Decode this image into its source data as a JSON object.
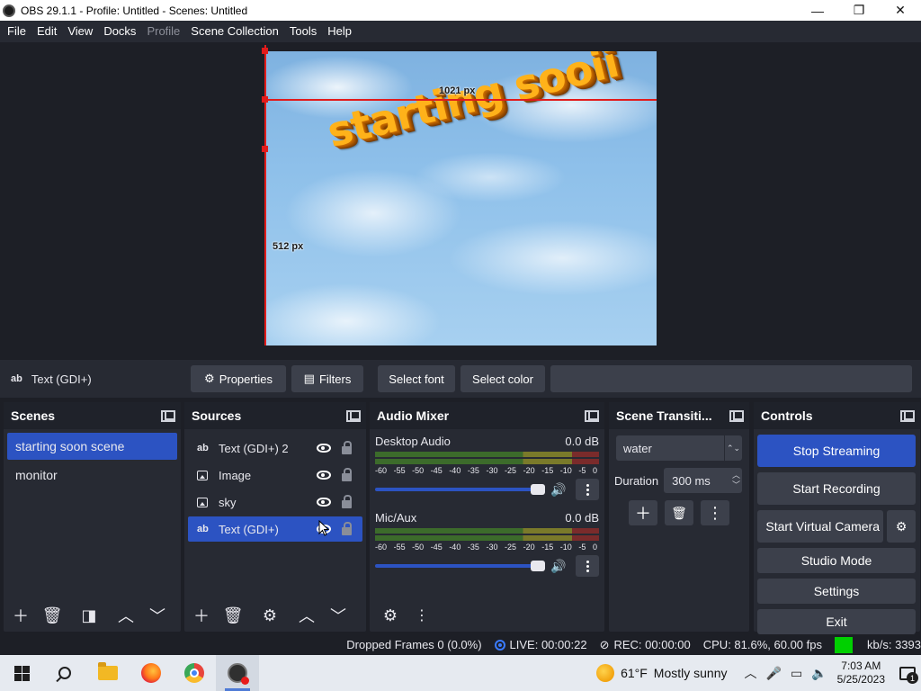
{
  "window": {
    "title": "OBS 29.1.1 - Profile: Untitled - Scenes: Untitled",
    "minimize": "—",
    "maximize": "❐",
    "close": "✕"
  },
  "menu": [
    "File",
    "Edit",
    "View",
    "Docks",
    "Profile",
    "Scene Collection",
    "Tools",
    "Help"
  ],
  "menu_disabled": [
    "Profile"
  ],
  "preview": {
    "text": "starting sooii",
    "width_label": "1021 px",
    "height_label": "512 px",
    "guide_color": "#e21b1b"
  },
  "context_bar": {
    "source_icon": "ab",
    "source_name": "Text (GDI+)",
    "properties": "Properties",
    "filters": "Filters",
    "select_font": "Select font",
    "select_color": "Select color"
  },
  "scenes": {
    "title": "Scenes",
    "items": [
      "starting soon scene",
      "monitor"
    ],
    "selected_index": 0
  },
  "sources": {
    "title": "Sources",
    "items": [
      {
        "name": "Text (GDI+) 2",
        "type": "text",
        "icon": "ab"
      },
      {
        "name": "Image",
        "type": "image"
      },
      {
        "name": "sky",
        "type": "image"
      },
      {
        "name": "Text (GDI+)",
        "type": "text",
        "icon": "ab"
      }
    ],
    "selected_index": 3
  },
  "audio_mixer": {
    "title": "Audio Mixer",
    "scale": [
      "-60",
      "-55",
      "-50",
      "-45",
      "-40",
      "-35",
      "-30",
      "-25",
      "-20",
      "-15",
      "-10",
      "-5",
      "0"
    ],
    "channels": [
      {
        "name": "Desktop Audio",
        "db": "0.0 dB",
        "volume": 1.0
      },
      {
        "name": "Mic/Aux",
        "db": "0.0 dB",
        "volume": 1.0
      }
    ]
  },
  "transitions": {
    "title": "Scene Transiti...",
    "selected": "water",
    "duration_label": "Duration",
    "duration_value": "300 ms"
  },
  "controls": {
    "title": "Controls",
    "stop_streaming": "Stop Streaming",
    "start_recording": "Start Recording",
    "start_virtual_camera": "Start Virtual Camera",
    "studio_mode": "Studio Mode",
    "settings": "Settings",
    "exit": "Exit"
  },
  "status": {
    "dropped_frames": "Dropped Frames 0 (0.0%)",
    "live": "LIVE: 00:00:22",
    "rec": "REC: 00:00:00",
    "cpu": "CPU: 81.6%, 60.00 fps",
    "kbs": "kb/s: 3393",
    "stream_health_color": "#00d000"
  },
  "taskbar": {
    "weather_temp": "61°F",
    "weather_desc": "Mostly sunny",
    "time": "7:03 AM",
    "date": "5/25/2023",
    "notification_count": "1"
  },
  "colors": {
    "accent": "#2c53c2",
    "panel": "#272a33",
    "background": "#1d1f26",
    "button": "#3c404b"
  }
}
